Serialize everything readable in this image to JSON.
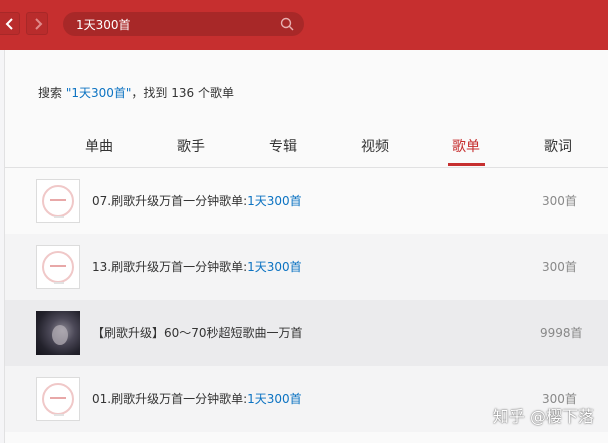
{
  "topbar": {
    "search_value": "1天300首",
    "accent_color": "#c62f2f"
  },
  "summary": {
    "prefix": "搜索 ",
    "keyword": "\"1天300首\"",
    "middle": "，找到 ",
    "count": "136",
    "suffix": " 个歌单"
  },
  "tabs": [
    {
      "label": "单曲",
      "active": false
    },
    {
      "label": "歌手",
      "active": false
    },
    {
      "label": "专辑",
      "active": false
    },
    {
      "label": "视频",
      "active": false
    },
    {
      "label": "歌单",
      "active": true
    },
    {
      "label": "歌词",
      "active": false
    }
  ],
  "results": [
    {
      "title": "07.刷歌升级万首一分钟歌单:",
      "highlight": "1天300首",
      "count": "300首",
      "cover": "default"
    },
    {
      "title": "13.刷歌升级万首一分钟歌单:",
      "highlight": "1天300首",
      "count": "300首",
      "cover": "default"
    },
    {
      "title": "【刷歌升级】60～70秒超短歌曲一万首",
      "highlight": "",
      "count": "9998首",
      "cover": "photo"
    },
    {
      "title": "01.刷歌升级万首一分钟歌单:",
      "highlight": "1天300首",
      "count": "300首",
      "cover": "default"
    }
  ],
  "watermark": "知乎 @樱下落"
}
